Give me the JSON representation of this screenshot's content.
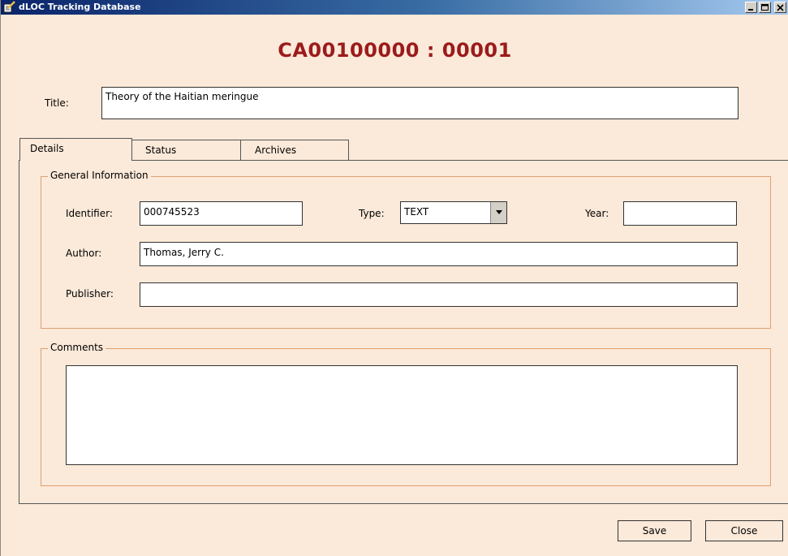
{
  "window": {
    "title": "dLOC Tracking Database",
    "controls": {
      "minimize": "_",
      "maximize": "□",
      "close": "×"
    }
  },
  "record": {
    "header": "CA00100000 : 00001"
  },
  "form": {
    "title_label": "Title:",
    "title_value": "Theory of the Haitian meringue"
  },
  "tabs": [
    {
      "label": "Details",
      "active": true
    },
    {
      "label": "Status",
      "active": false
    },
    {
      "label": "Archives",
      "active": false
    }
  ],
  "details": {
    "general_information": {
      "legend": "General Information",
      "identifier_label": "Identifier:",
      "identifier_value": "000745523",
      "type_label": "Type:",
      "type_value": "TEXT",
      "year_label": "Year:",
      "year_value": "",
      "author_label": "Author:",
      "author_value": "Thomas, Jerry C.",
      "publisher_label": "Publisher:",
      "publisher_value": ""
    },
    "comments": {
      "legend": "Comments",
      "value": ""
    }
  },
  "buttons": {
    "save": "Save",
    "close": "Close"
  },
  "colors": {
    "background": "#fbe9d9",
    "header_text": "#9b1b1b",
    "group_border": "#e0a070",
    "titlebar": "#0a246a"
  },
  "icons": {
    "app": "notepad-pencil-icon",
    "dropdown": "chevron-down-icon"
  }
}
